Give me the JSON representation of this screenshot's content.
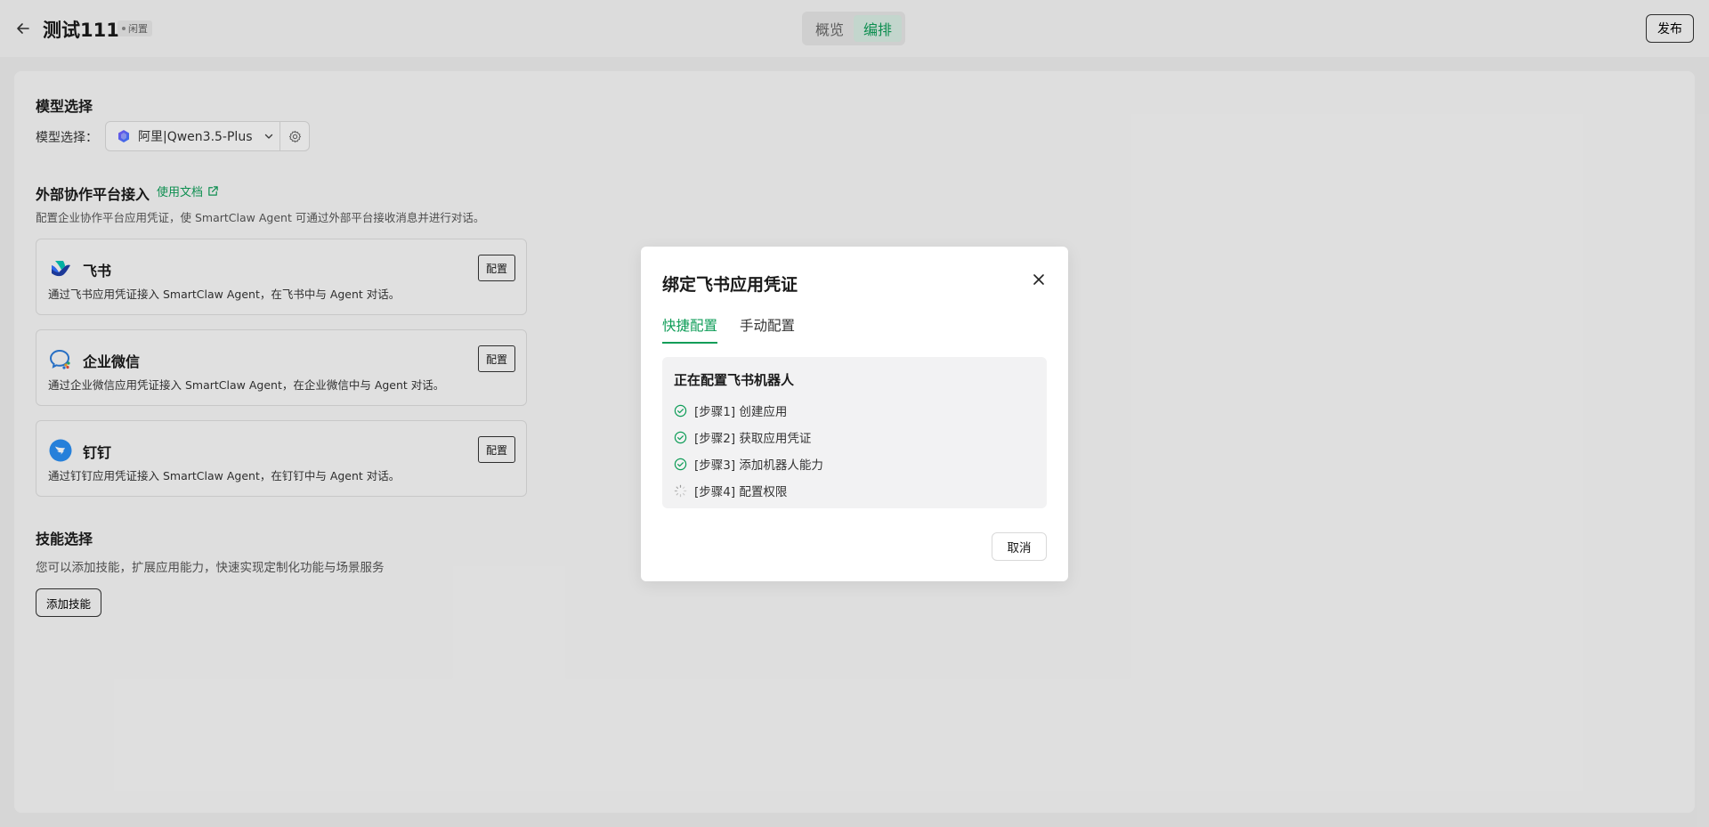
{
  "header": {
    "title": "测试111",
    "status": "闲置",
    "tabs": [
      {
        "label": "概览",
        "active": false
      },
      {
        "label": "编排",
        "active": true
      }
    ],
    "publish_label": "发布"
  },
  "model": {
    "section_title": "模型选择",
    "field_label": "模型选择：",
    "selected": "阿里|Qwen3.5-Plus"
  },
  "platform": {
    "section_title": "外部协作平台接入",
    "doc_link": "使用文档",
    "description": "配置企业协作平台应用凭证，使 SmartClaw Agent 可通过外部平台接收消息并进行对话。",
    "cards": [
      {
        "name": "飞书",
        "desc": "通过飞书应用凭证接入 SmartClaw Agent，在飞书中与 Agent 对话。",
        "button": "配置"
      },
      {
        "name": "企业微信",
        "desc": "通过企业微信应用凭证接入 SmartClaw Agent，在企业微信中与 Agent 对话。",
        "button": "配置"
      },
      {
        "name": "钉钉",
        "desc": "通过钉钉应用凭证接入 SmartClaw Agent，在钉钉中与 Agent 对话。",
        "button": "配置"
      }
    ]
  },
  "skills": {
    "section_title": "技能选择",
    "description": "您可以添加技能，扩展应用能力，快速实现定制化功能与场景服务",
    "add_button": "添加技能"
  },
  "modal": {
    "title": "绑定飞书应用凭证",
    "tabs": [
      {
        "label": "快捷配置",
        "active": true
      },
      {
        "label": "手动配置",
        "active": false
      }
    ],
    "progress_title": "正在配置飞书机器人",
    "steps": [
      {
        "label": "[步骤1] 创建应用",
        "status": "done"
      },
      {
        "label": "[步骤2] 获取应用凭证",
        "status": "done"
      },
      {
        "label": "[步骤3] 添加机器人能力",
        "status": "done"
      },
      {
        "label": "[步骤4] 配置权限",
        "status": "loading"
      }
    ],
    "cancel_label": "取消"
  },
  "colors": {
    "accent": "#0f9d58",
    "background": "#ececec"
  }
}
